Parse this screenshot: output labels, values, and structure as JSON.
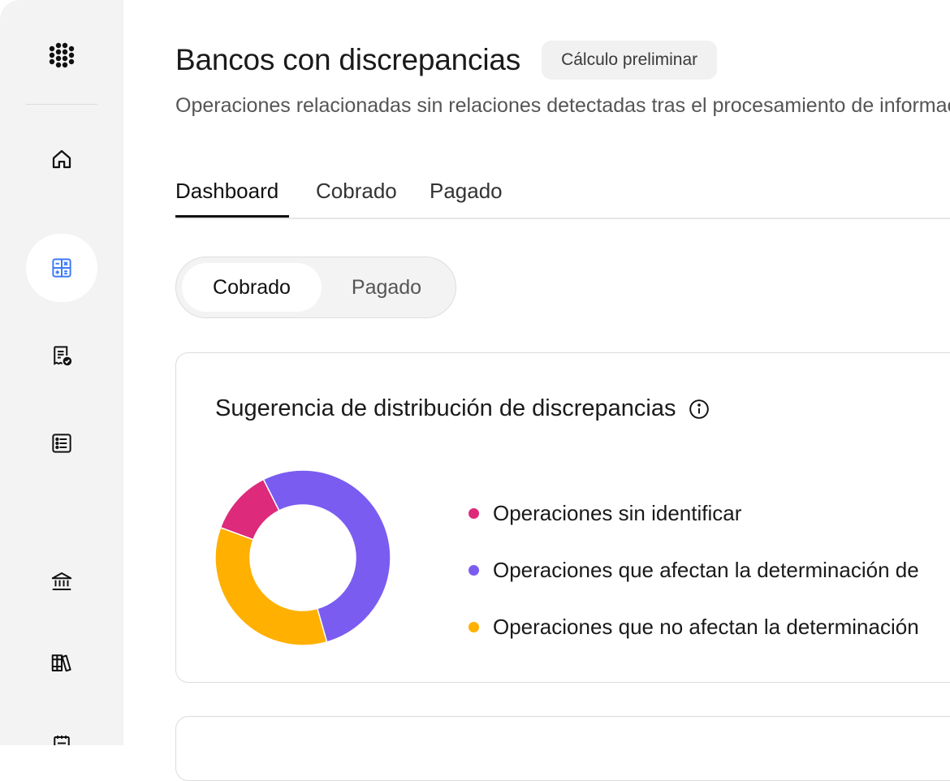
{
  "header": {
    "title": "Bancos con discrepancias",
    "badge": "Cálculo preliminar",
    "subtitle": "Operaciones relacionadas sin relaciones detectadas tras el procesamiento de información"
  },
  "tabs": [
    {
      "label": "Dashboard",
      "active": true
    },
    {
      "label": "Cobrado",
      "active": false
    },
    {
      "label": "Pagado",
      "active": false
    }
  ],
  "segmented": {
    "options": [
      {
        "label": "Cobrado",
        "active": true
      },
      {
        "label": "Pagado",
        "active": false
      }
    ]
  },
  "card": {
    "title": "Sugerencia de distribución de discrepancias"
  },
  "chart_data": {
    "type": "pie",
    "title": "Sugerencia de distribución de discrepancias",
    "series": [
      {
        "name": "Operaciones sin identificar",
        "value": 12,
        "color": "#dd2a7b"
      },
      {
        "name": "Operaciones que afectan la determinación de",
        "value": 53,
        "color": "#7b5cf0"
      },
      {
        "name": "Operaciones que no afectan la determinación",
        "value": 35,
        "color": "#ffb000"
      }
    ]
  },
  "colors": {
    "accent": "#3d7bf7",
    "sidebar_bg": "#f3f3f3"
  },
  "sidebar": {
    "items": [
      {
        "icon": "home-icon",
        "active": false
      },
      {
        "icon": "calculator-icon",
        "active": true
      },
      {
        "icon": "receipt-check-icon",
        "active": false
      },
      {
        "icon": "list-icon",
        "active": false
      },
      {
        "icon": "bank-icon",
        "active": false
      },
      {
        "icon": "books-icon",
        "active": false
      },
      {
        "icon": "document-icon",
        "active": false
      }
    ]
  }
}
